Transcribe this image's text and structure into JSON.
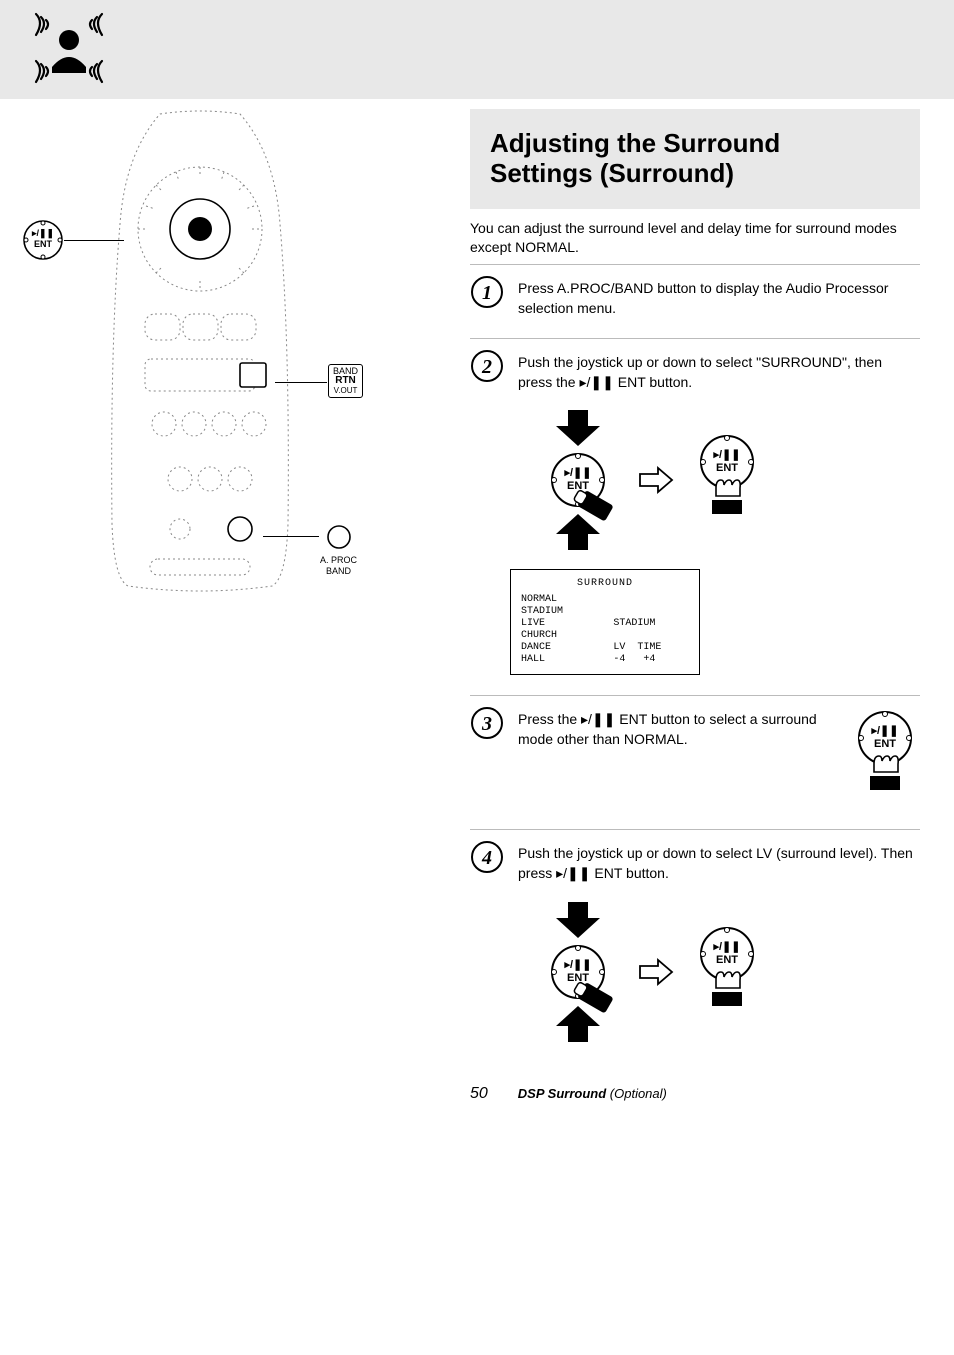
{
  "header": {},
  "labels": {
    "ent_play_pause": "▸/❚❚",
    "ent": "ENT",
    "band_rtn_vout_l1": "BAND",
    "band_rtn_vout_l2": "RTN",
    "band_rtn_vout_l3": "V.OUT",
    "aproc_l1": "A. PROC",
    "aproc_l2": "BAND"
  },
  "title": {
    "line1": "Adjusting the Surround",
    "line2": "Settings (Surround)",
    "sub": "You can adjust the surround level and delay time for surround modes except NORMAL."
  },
  "steps": {
    "s1": "Press A.PROC/BAND button to display the Audio Processor selection menu.",
    "s2": "Push the joystick up or down to select \"SURROUND\", then press the ▸/❚❚ ENT button.",
    "s3_a": "Press the ",
    "s3_b": " ENT button to select a surround mode other than NORMAL.",
    "s4_a": "Push the joystick up or down to select LV (surround level). Then press ",
    "s4_b": " ENT button."
  },
  "screen": {
    "title": "SURROUND",
    "left_items": [
      "NORMAL",
      "STADIUM",
      "LIVE",
      "CHURCH",
      "DANCE",
      "HALL"
    ],
    "right_top": "STADIUM",
    "lv_label": "LV",
    "time_label": "TIME",
    "lv_val": "-4",
    "time_val": "+4"
  },
  "footer": {
    "page": "50",
    "section_bold": "DSP Surround",
    "section_rest": "(Optional)"
  }
}
